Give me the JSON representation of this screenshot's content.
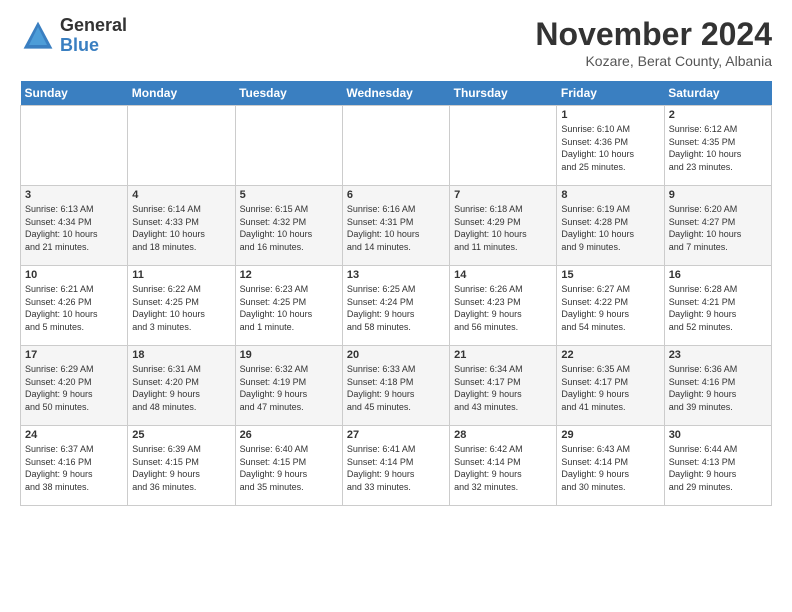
{
  "logo": {
    "general": "General",
    "blue": "Blue"
  },
  "title": "November 2024",
  "subtitle": "Kozare, Berat County, Albania",
  "headers": [
    "Sunday",
    "Monday",
    "Tuesday",
    "Wednesday",
    "Thursday",
    "Friday",
    "Saturday"
  ],
  "weeks": [
    [
      {
        "day": "",
        "lines": []
      },
      {
        "day": "",
        "lines": []
      },
      {
        "day": "",
        "lines": []
      },
      {
        "day": "",
        "lines": []
      },
      {
        "day": "",
        "lines": []
      },
      {
        "day": "1",
        "lines": [
          "Sunrise: 6:10 AM",
          "Sunset: 4:36 PM",
          "Daylight: 10 hours",
          "and 25 minutes."
        ]
      },
      {
        "day": "2",
        "lines": [
          "Sunrise: 6:12 AM",
          "Sunset: 4:35 PM",
          "Daylight: 10 hours",
          "and 23 minutes."
        ]
      }
    ],
    [
      {
        "day": "3",
        "lines": [
          "Sunrise: 6:13 AM",
          "Sunset: 4:34 PM",
          "Daylight: 10 hours",
          "and 21 minutes."
        ]
      },
      {
        "day": "4",
        "lines": [
          "Sunrise: 6:14 AM",
          "Sunset: 4:33 PM",
          "Daylight: 10 hours",
          "and 18 minutes."
        ]
      },
      {
        "day": "5",
        "lines": [
          "Sunrise: 6:15 AM",
          "Sunset: 4:32 PM",
          "Daylight: 10 hours",
          "and 16 minutes."
        ]
      },
      {
        "day": "6",
        "lines": [
          "Sunrise: 6:16 AM",
          "Sunset: 4:31 PM",
          "Daylight: 10 hours",
          "and 14 minutes."
        ]
      },
      {
        "day": "7",
        "lines": [
          "Sunrise: 6:18 AM",
          "Sunset: 4:29 PM",
          "Daylight: 10 hours",
          "and 11 minutes."
        ]
      },
      {
        "day": "8",
        "lines": [
          "Sunrise: 6:19 AM",
          "Sunset: 4:28 PM",
          "Daylight: 10 hours",
          "and 9 minutes."
        ]
      },
      {
        "day": "9",
        "lines": [
          "Sunrise: 6:20 AM",
          "Sunset: 4:27 PM",
          "Daylight: 10 hours",
          "and 7 minutes."
        ]
      }
    ],
    [
      {
        "day": "10",
        "lines": [
          "Sunrise: 6:21 AM",
          "Sunset: 4:26 PM",
          "Daylight: 10 hours",
          "and 5 minutes."
        ]
      },
      {
        "day": "11",
        "lines": [
          "Sunrise: 6:22 AM",
          "Sunset: 4:25 PM",
          "Daylight: 10 hours",
          "and 3 minutes."
        ]
      },
      {
        "day": "12",
        "lines": [
          "Sunrise: 6:23 AM",
          "Sunset: 4:25 PM",
          "Daylight: 10 hours",
          "and 1 minute."
        ]
      },
      {
        "day": "13",
        "lines": [
          "Sunrise: 6:25 AM",
          "Sunset: 4:24 PM",
          "Daylight: 9 hours",
          "and 58 minutes."
        ]
      },
      {
        "day": "14",
        "lines": [
          "Sunrise: 6:26 AM",
          "Sunset: 4:23 PM",
          "Daylight: 9 hours",
          "and 56 minutes."
        ]
      },
      {
        "day": "15",
        "lines": [
          "Sunrise: 6:27 AM",
          "Sunset: 4:22 PM",
          "Daylight: 9 hours",
          "and 54 minutes."
        ]
      },
      {
        "day": "16",
        "lines": [
          "Sunrise: 6:28 AM",
          "Sunset: 4:21 PM",
          "Daylight: 9 hours",
          "and 52 minutes."
        ]
      }
    ],
    [
      {
        "day": "17",
        "lines": [
          "Sunrise: 6:29 AM",
          "Sunset: 4:20 PM",
          "Daylight: 9 hours",
          "and 50 minutes."
        ]
      },
      {
        "day": "18",
        "lines": [
          "Sunrise: 6:31 AM",
          "Sunset: 4:20 PM",
          "Daylight: 9 hours",
          "and 48 minutes."
        ]
      },
      {
        "day": "19",
        "lines": [
          "Sunrise: 6:32 AM",
          "Sunset: 4:19 PM",
          "Daylight: 9 hours",
          "and 47 minutes."
        ]
      },
      {
        "day": "20",
        "lines": [
          "Sunrise: 6:33 AM",
          "Sunset: 4:18 PM",
          "Daylight: 9 hours",
          "and 45 minutes."
        ]
      },
      {
        "day": "21",
        "lines": [
          "Sunrise: 6:34 AM",
          "Sunset: 4:17 PM",
          "Daylight: 9 hours",
          "and 43 minutes."
        ]
      },
      {
        "day": "22",
        "lines": [
          "Sunrise: 6:35 AM",
          "Sunset: 4:17 PM",
          "Daylight: 9 hours",
          "and 41 minutes."
        ]
      },
      {
        "day": "23",
        "lines": [
          "Sunrise: 6:36 AM",
          "Sunset: 4:16 PM",
          "Daylight: 9 hours",
          "and 39 minutes."
        ]
      }
    ],
    [
      {
        "day": "24",
        "lines": [
          "Sunrise: 6:37 AM",
          "Sunset: 4:16 PM",
          "Daylight: 9 hours",
          "and 38 minutes."
        ]
      },
      {
        "day": "25",
        "lines": [
          "Sunrise: 6:39 AM",
          "Sunset: 4:15 PM",
          "Daylight: 9 hours",
          "and 36 minutes."
        ]
      },
      {
        "day": "26",
        "lines": [
          "Sunrise: 6:40 AM",
          "Sunset: 4:15 PM",
          "Daylight: 9 hours",
          "and 35 minutes."
        ]
      },
      {
        "day": "27",
        "lines": [
          "Sunrise: 6:41 AM",
          "Sunset: 4:14 PM",
          "Daylight: 9 hours",
          "and 33 minutes."
        ]
      },
      {
        "day": "28",
        "lines": [
          "Sunrise: 6:42 AM",
          "Sunset: 4:14 PM",
          "Daylight: 9 hours",
          "and 32 minutes."
        ]
      },
      {
        "day": "29",
        "lines": [
          "Sunrise: 6:43 AM",
          "Sunset: 4:14 PM",
          "Daylight: 9 hours",
          "and 30 minutes."
        ]
      },
      {
        "day": "30",
        "lines": [
          "Sunrise: 6:44 AM",
          "Sunset: 4:13 PM",
          "Daylight: 9 hours",
          "and 29 minutes."
        ]
      }
    ]
  ]
}
